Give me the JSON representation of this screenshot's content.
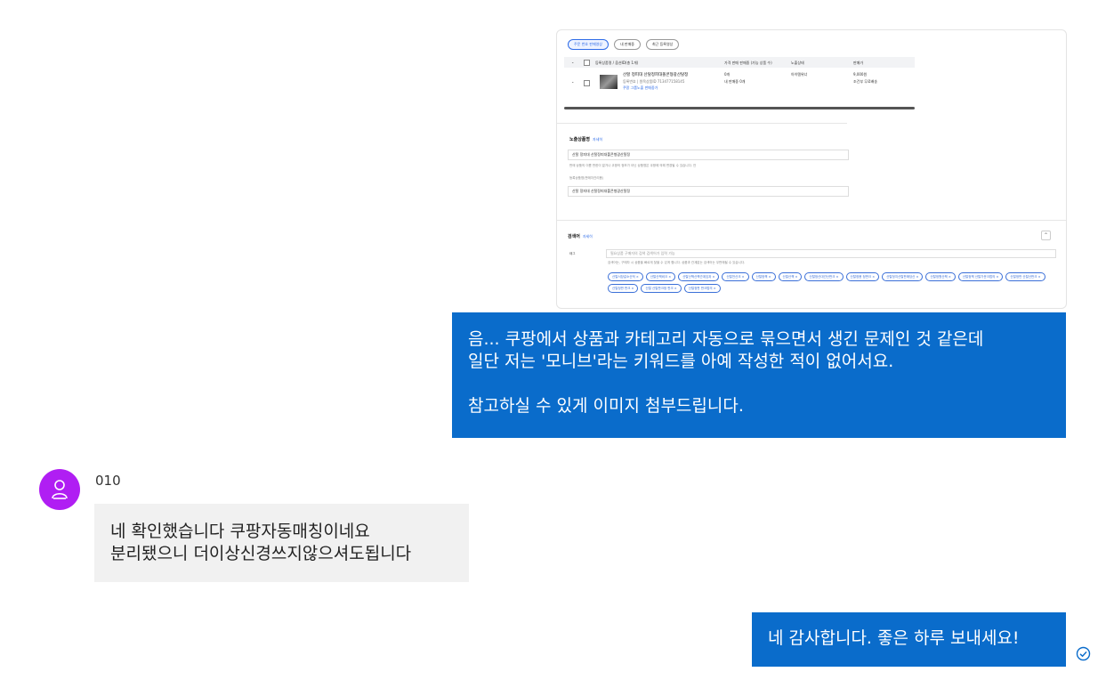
{
  "attachment": {
    "tabs": [
      "주문 번호 판매영상",
      "내 판매중",
      "최근 등록영상"
    ],
    "table_header": [
      "등록상품명 / 옵션ID(총 1개)",
      "가격 판매 판매중 (가능 상품 수)",
      "노출상태",
      "판매가"
    ],
    "row": {
      "name": "산할 정피대 산탈정피대폴콘형광산탈정",
      "id": "등록번호 | 원목상품ID 713477158145",
      "link": "쿠팡 그룹노출 판매중가",
      "stock": "0개",
      "sub_stock": "내 판매중 0개",
      "status": "아이템위너",
      "price": "9,000원",
      "price_sub": "조건부 무료배송"
    },
    "section_display": {
      "title": "노출상품명",
      "tag": "자세히",
      "value1": "산탈 정피대 산탈정피대폴콘형광산탈정",
      "note": "판매 상품의 이름 판한이 없거나 쿠팡의 정보가 아닌 상품명은 쿠팡에 의해 변경될 수 있습니다. 안",
      "label2": "등록상품명(판매자관리용)",
      "value2": "산탈 정피대 산탈정피대폴콘형광산탈정"
    },
    "section_keyword": {
      "title": "검색어",
      "tag": "자세히",
      "label": "태그",
      "placeholder": "필요상품 구매자의 검색 검색어가 입력 가능",
      "note": "검색어는, 구매자 시 상품을 빠르게 찾을 수 있게 합니다. 상품과 관계없는 검색어는 무판매될 수 있습니다.",
      "chips": [
        "산탈서장갈소산적",
        "산탈산책비크",
        "산탈산책산책관계임과",
        "산탈전산크",
        "산탈정책",
        "산탈산책",
        "산탈정산대관산판크",
        "산탈정용 정판크",
        "산탈정지산탈판매당산",
        "산탈정원산책",
        "산탈정책 산탈가운크법의",
        "산탈정판 산탈산판크",
        "산탈정판 판크",
        "산탈 산탈판크정 판크",
        "산탈정판 판크법의"
      ]
    }
  },
  "messages": {
    "out1": "음... 쿠팡에서 상품과 카테고리 자동으로 묶으면서 생긴 문제인 것 같은데\n일단 저는 '모니브'라는 키워드를 아예 작성한 적이 없어서요.\n\n참고하실 수 있게 이미지 첨부드립니다.",
    "sender": "010",
    "in1": "네 확인했습니다 쿠팡자동매칭이네요\n분리됐으니 더이상신경쓰지않으셔도됩니다",
    "out2": "네 감사합니다. 좋은 하루 보내세요!"
  },
  "colors": {
    "outgoing_bubble": "#0a6ccb",
    "incoming_bubble": "#f1f1f1",
    "avatar": "#b01ef3",
    "read_icon": "#0a6ccb"
  },
  "icons": {
    "avatar": "person-icon",
    "read": "check-circle-icon"
  }
}
